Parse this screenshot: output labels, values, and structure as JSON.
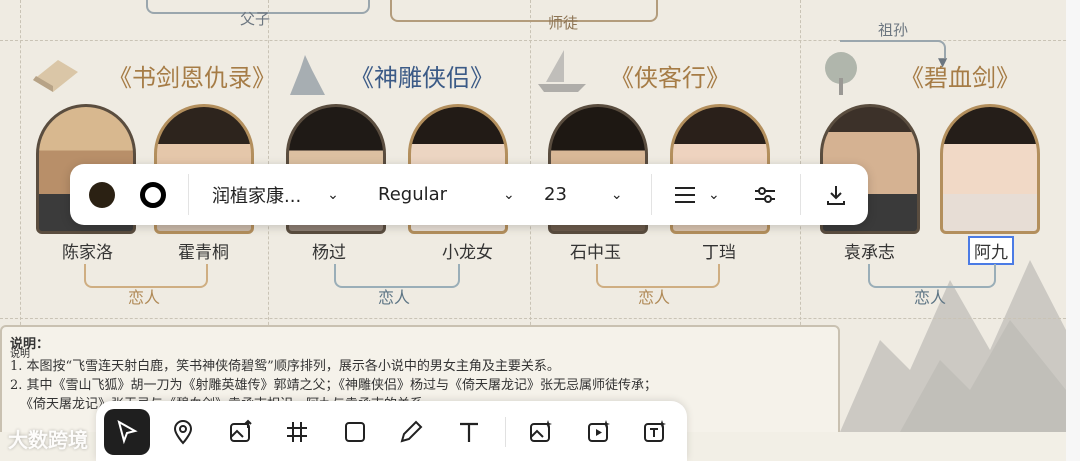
{
  "tree": {
    "labels": [
      "父子",
      "师徒",
      "祖孙"
    ]
  },
  "novels": [
    {
      "title": "《书剑恩仇录》",
      "color": "#a67c46"
    },
    {
      "title": "《神雕侠侣》",
      "color": "#3b5a86"
    },
    {
      "title": "《侠客行》",
      "color": "#a67c46"
    },
    {
      "title": "《碧血剑》",
      "color": "#a67c46"
    }
  ],
  "names": [
    "陈家洛",
    "霍青桐",
    "杨过",
    "小龙女",
    "石中玉",
    "丁珰",
    "袁承志",
    "阿九"
  ],
  "relations": [
    "恋人",
    "恋人",
    "恋人",
    "恋人"
  ],
  "notes": {
    "tag": "说明",
    "heading": "说明：",
    "line1": "1. 本图按“飞雪连天射白鹿，笑书神侠倚碧鸳”顺序排列，展示各小说中的男女主角及主要关系。",
    "line2": "2. 其中《雪山飞狐》胡一刀为《射雕英雄传》郭靖之父；《神雕侠侣》杨过与《倚天屠龙记》张无忌属师徒传承；",
    "line3": "《倚天屠龙记》张无忌与《碧血剑》袁承志相识，阿九与袁承志的关系"
  },
  "text_toolbar": {
    "font_family": "润植家康...",
    "font_style": "Regular",
    "font_size": "23",
    "fill_color": "#2b2113",
    "stroke_color": "#000000"
  },
  "bottom_toolbar": {
    "tools": [
      "select-cursor-icon",
      "pin-icon",
      "image-upload-icon",
      "grid-icon",
      "rectangle-icon",
      "pencil-icon",
      "text-icon",
      "ai-image-icon",
      "ai-video-icon",
      "ai-text-icon"
    ]
  },
  "watermark": "大数跨境"
}
